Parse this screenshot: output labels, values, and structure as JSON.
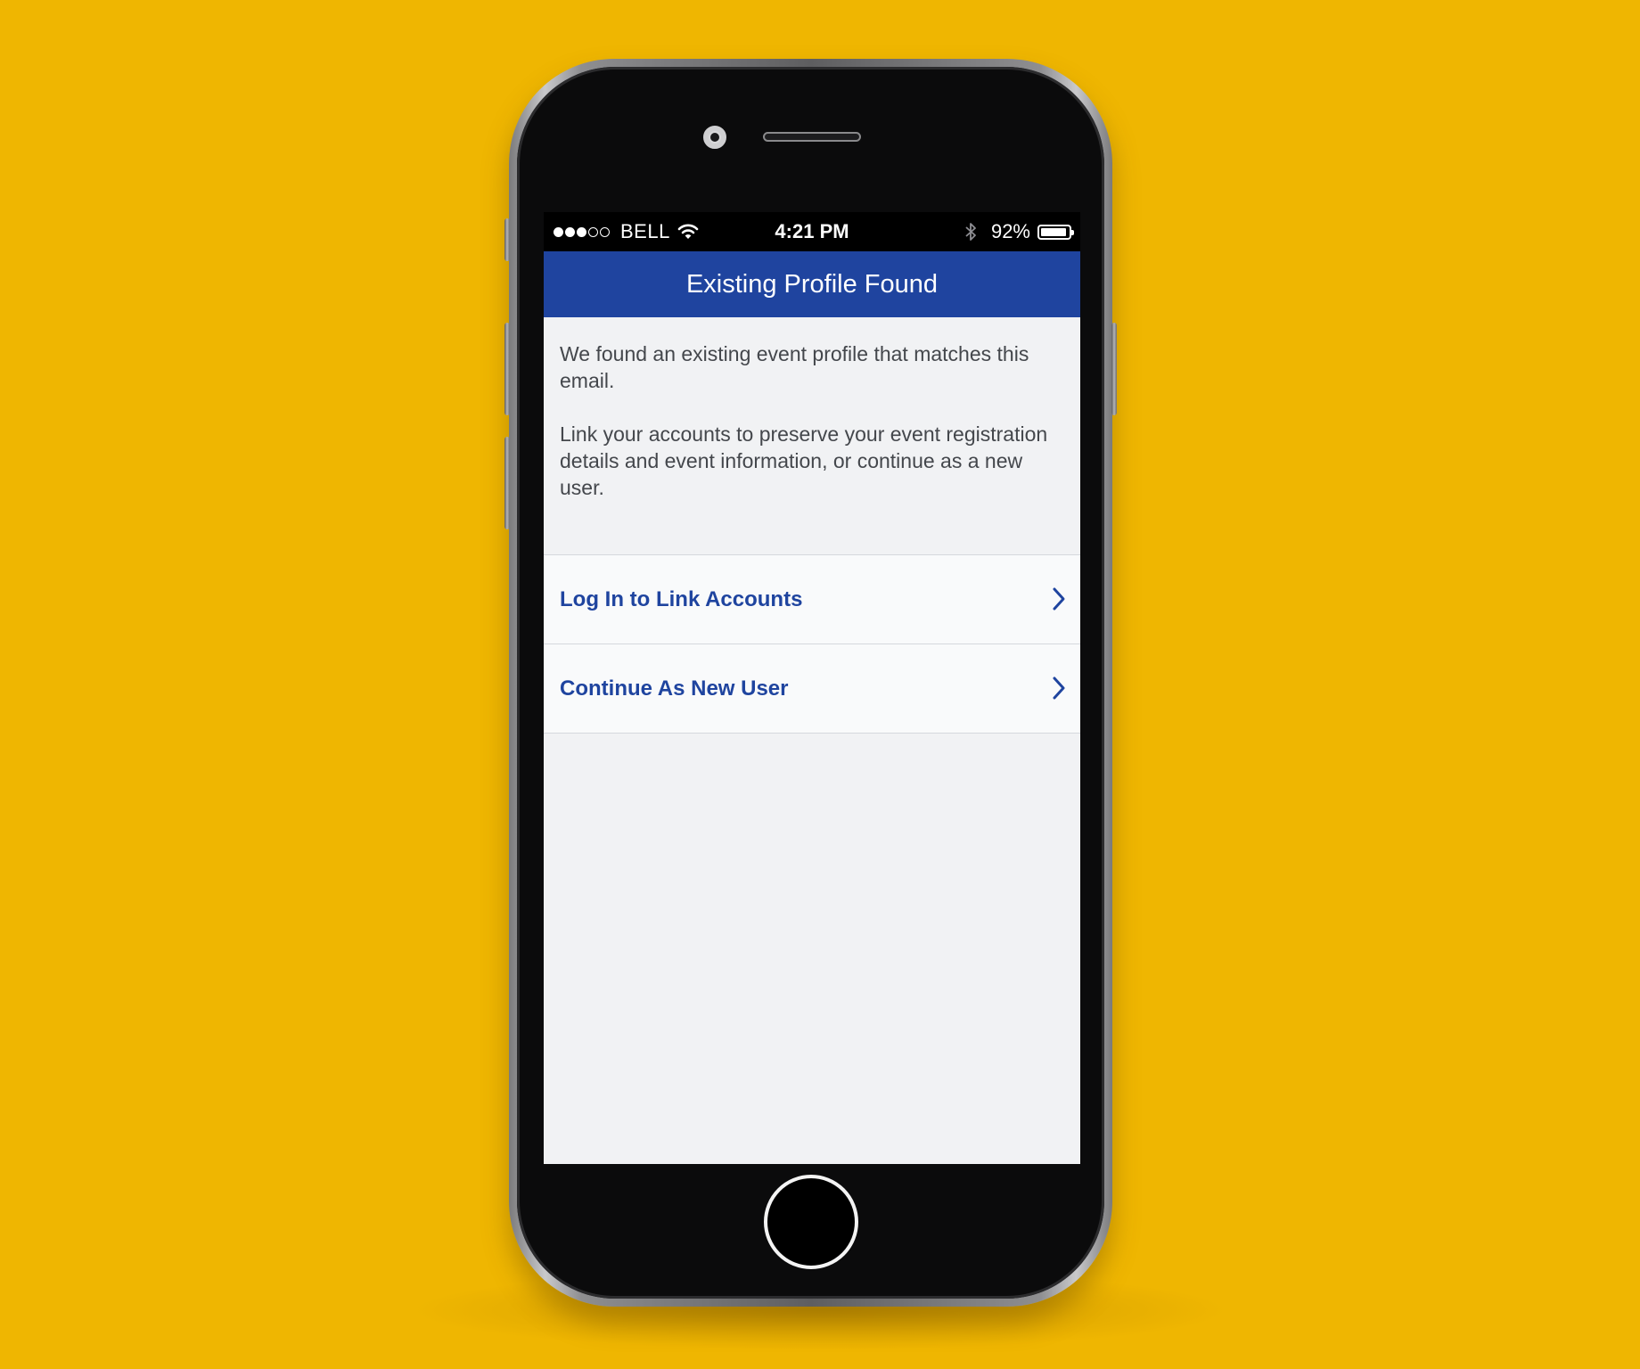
{
  "status_bar": {
    "carrier": "BELL",
    "time": "4:21 PM",
    "battery_percent": "92%",
    "battery_level": 0.92,
    "signal_strength": "3 of 5 dots"
  },
  "nav_bar": {
    "title": "Existing Profile Found"
  },
  "message": {
    "paragraph_1": "We found an existing event profile that matches this email.",
    "paragraph_2": "Link your accounts to preserve your event registration details and event information, or continue as a new user."
  },
  "actions": [
    {
      "label": "Log In to Link Accounts",
      "icon": "chevron-right-icon"
    },
    {
      "label": "Continue As New User",
      "icon": "chevron-right-icon"
    }
  ],
  "colors": {
    "background": "#efb601",
    "accent": "#1f449f",
    "screen_bg": "#f1f2f4"
  }
}
